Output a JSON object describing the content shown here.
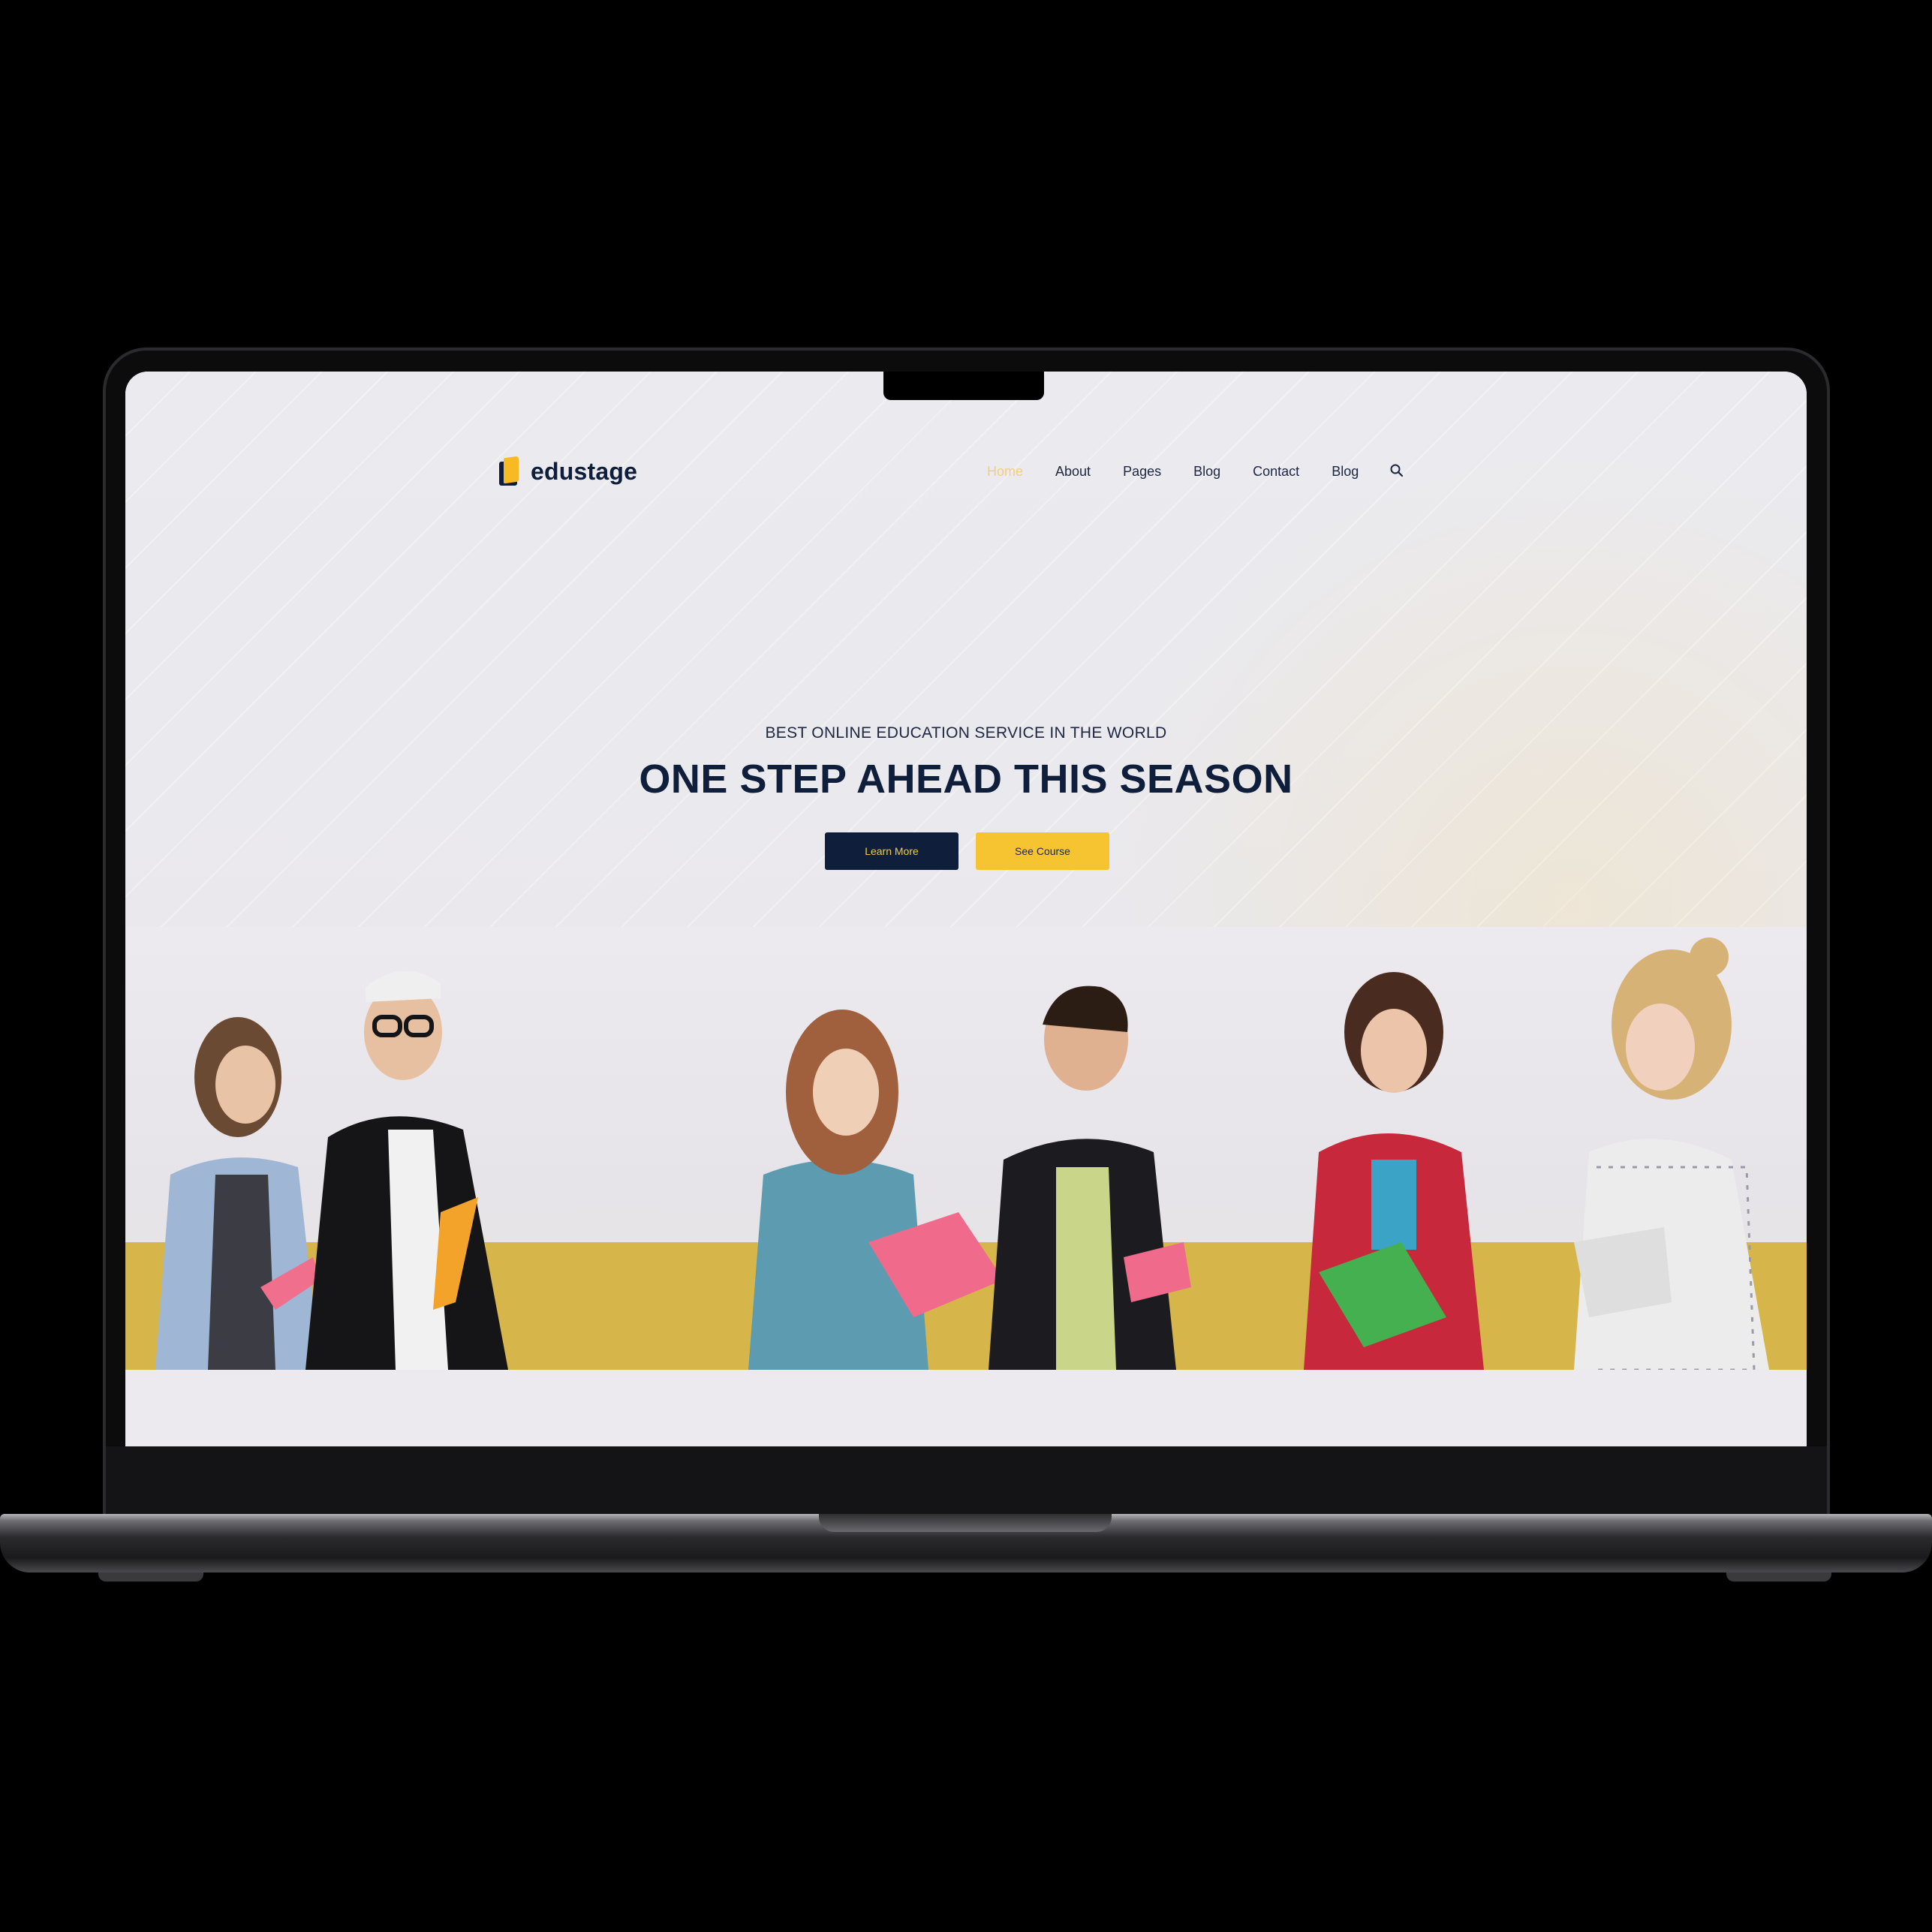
{
  "brand": {
    "name": "edustage",
    "logo_icon": "book-logo-icon",
    "colors": {
      "navy": "#0f1e3a",
      "yellow": "#f7c431"
    }
  },
  "nav": {
    "items": [
      "Home",
      "About",
      "Pages",
      "Blog",
      "Contact",
      "Blog"
    ],
    "active_index": 0,
    "search_icon": "search-icon"
  },
  "hero": {
    "eyebrow": "BEST ONLINE EDUCATION SERVICE IN THE WORLD",
    "headline": "ONE STEP AHEAD THIS SEASON",
    "primary_button": "Learn More",
    "secondary_button": "See Course"
  }
}
